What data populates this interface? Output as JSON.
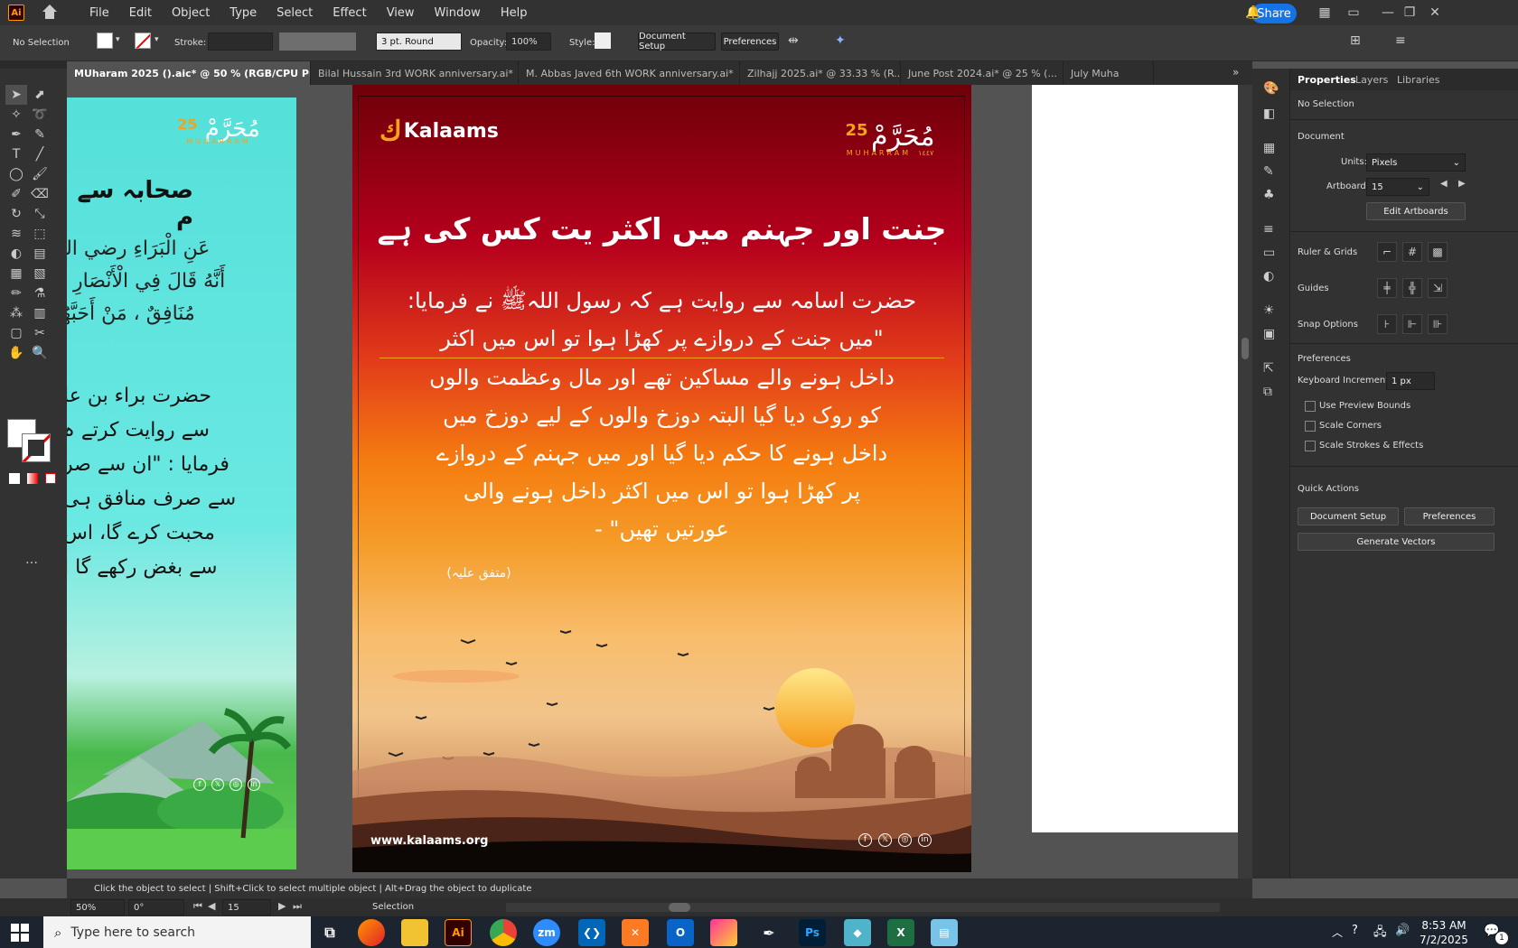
{
  "menubar": {
    "app_logo": "Ai",
    "items": [
      "File",
      "Edit",
      "Object",
      "Type",
      "Select",
      "Effect",
      "View",
      "Window",
      "Help"
    ],
    "share_label": "Share"
  },
  "controlbar": {
    "selection": "No Selection",
    "stroke_label": "Stroke:",
    "brush_value": "3 pt. Round",
    "opacity_label": "Opacity:",
    "opacity_value": "100%",
    "style_label": "Style:",
    "document_setup": "Document Setup",
    "preferences": "Preferences"
  },
  "tabs": [
    {
      "label": "MUharam 2025 ().aic* @ 50 % (RGB/CPU Preview)",
      "active": true
    },
    {
      "label": "Bilal Hussain  3rd  WORK anniversary.ai*",
      "active": false
    },
    {
      "label": "M. Abbas Javed  6th  WORK anniversary.ai*",
      "active": false
    },
    {
      "label": "Zilhajj 2025.ai* @ 33.33 % (R...",
      "active": false
    },
    {
      "label": "June Post 2024.ai* @ 25 % (...",
      "active": false
    },
    {
      "label": "July Muha",
      "active": false
    }
  ],
  "panel": {
    "tabs": [
      "Properties",
      "Layers",
      "Libraries"
    ],
    "no_selection": "No Selection",
    "document": "Document",
    "units_label": "Units:",
    "units_value": "Pixels",
    "artboard_label": "Artboard:",
    "artboard_value": "15",
    "edit_artboards": "Edit Artboards",
    "ruler_grids": "Ruler & Grids",
    "guides": "Guides",
    "snap_options": "Snap Options",
    "preferences": "Preferences",
    "keyboard_increment_label": "Keyboard Increment:",
    "keyboard_increment_value": "1 px",
    "use_preview_bounds": "Use Preview Bounds",
    "scale_corners": "Scale Corners",
    "scale_strokes": "Scale Strokes & Effects",
    "quick_actions": "Quick Actions",
    "document_setup_btn": "Document Setup",
    "preferences_btn": "Preferences",
    "generate_vectors": "Generate Vectors"
  },
  "statusbar": {
    "hint": "Click the object to select  |  Shift+Click to select multiple object  |  Alt+Drag the object to duplicate",
    "zoom": "50%",
    "rotation": "0°",
    "artboard_nav": "15",
    "tool": "Selection"
  },
  "taskbar": {
    "search_placeholder": "Type here to search",
    "time": "8:53 AM",
    "date": "7/2/2025",
    "notif_count": "1",
    "apps": [
      "zm",
      "Ps"
    ]
  },
  "artboard_main": {
    "brand": "Kalaams",
    "badge_number": "25",
    "badge_script": "مُحَرَّمْ",
    "badge_word": "MUHARRAM",
    "badge_year": "١٤٤٧",
    "title": "جنت اور جہنم میں اکثر یت کس کی ہے",
    "body": [
      "حضرت اسامہ سے روایت ہے کہ رسول اللہﷺ نے فرمایا:",
      "\"میں جنت کے دروازے پر کھڑا ہوا تو اس میں اکثر",
      "داخل ہونے والے مساکین تھے اور مال وعظمت والوں",
      "کو روک دیا گیا البتہ دوزخ والوں کے لیے دوزخ میں",
      "داخل ہونے کا حکم دیا گیا اور میں جہنم کے دروازے",
      "پر کھڑا ہوا تو اس میں اکثر داخل ہونے والی",
      "عورتیں تھیں\" -"
    ],
    "reference": "(متفق علیہ)",
    "website": "www.kalaams.org",
    "social": [
      "f",
      "𝕏",
      "◎",
      "in"
    ]
  },
  "artboard_left": {
    "badge_number": "25",
    "badge_script": "مُحَرَّمْ",
    "badge_word": "MUHARRAM",
    "heading": "صحابہ سے م",
    "arabic": [
      "عَنِ الْبَرَاءِ رضي الله",
      "أَنَّهُ قَالَ فِي الْأَنْصَارِ :لَا",
      "مُنَافِقٌ ، مَنْ أَحَبَّهُمْ"
    ],
    "urdu": [
      "حضرت براء بن عا",
      "سے روایت کرتے ہ",
      "فرمایا : \"ان سے صر",
      "سے صرف منافق ہی",
      "محبت کرے گا، اس",
      "سے بغض رکھے گا ا"
    ],
    "social": [
      "f",
      "𝕏",
      "◎",
      "in"
    ]
  }
}
